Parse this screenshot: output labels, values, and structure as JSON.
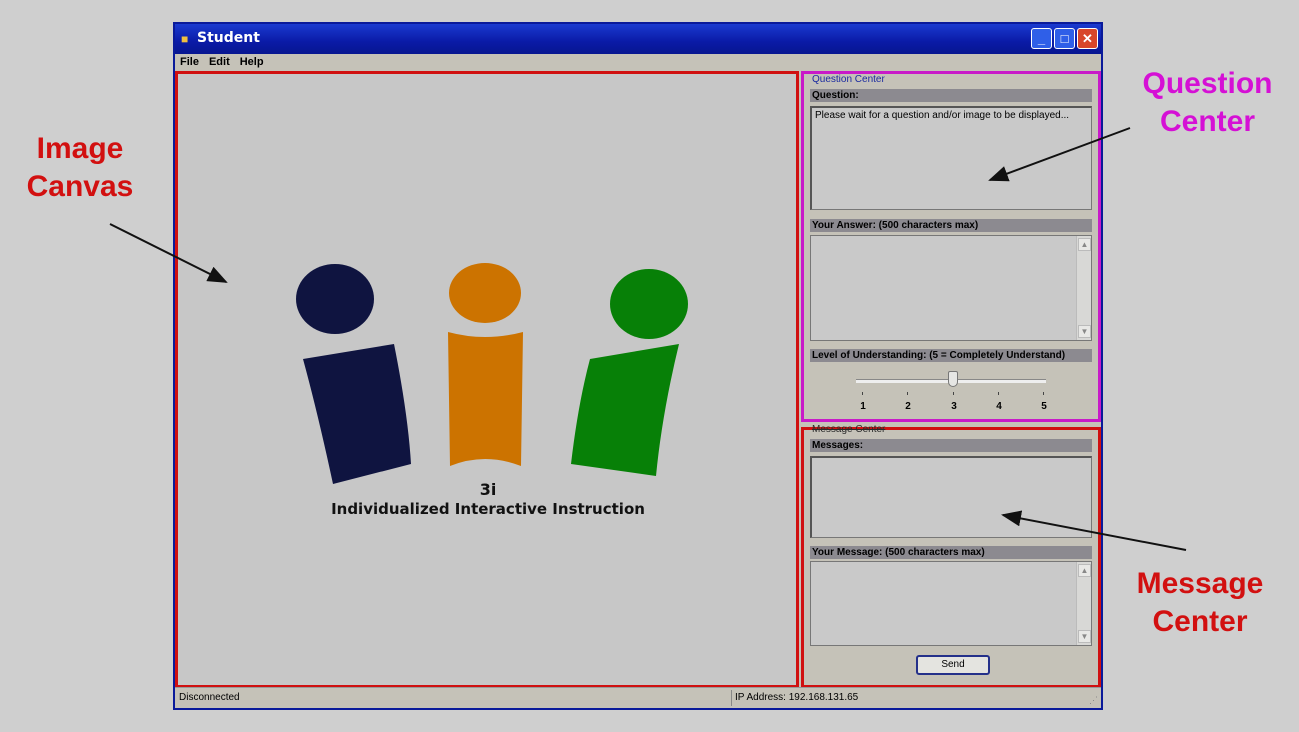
{
  "annotations": {
    "image_canvas": "Image\nCanvas",
    "question_center": "Question\nCenter",
    "message_center": "Message\nCenter"
  },
  "window": {
    "title": "Student",
    "menu": [
      "File",
      "Edit",
      "Help"
    ]
  },
  "canvas": {
    "logo_name": "3i",
    "logo_subtitle": "Individualized Interactive Instruction",
    "logo_colors": [
      "#0f1440",
      "#cc7300",
      "#078007"
    ]
  },
  "question_center": {
    "title": "Question Center",
    "question_label": "Question:",
    "question_text": "Please wait for a question and/or image to be displayed...",
    "answer_label": "Your Answer: (500 characters max)",
    "answer_value": "",
    "understanding_label": "Level of Understanding: (5 = Completely Understand)",
    "scale": [
      "1",
      "2",
      "3",
      "4",
      "5"
    ],
    "selected_level": 3
  },
  "message_center": {
    "title": "Message Center",
    "messages_label": "Messages:",
    "messages_value": "",
    "your_message_label": "Your Message: (500 characters max)",
    "your_message_value": "",
    "send_label": "Send"
  },
  "status": {
    "connection": "Disconnected",
    "ip": "IP Address: 192.168.131.65"
  },
  "colors": {
    "canvas_border": "#d01010",
    "question_border": "#c81ac8",
    "titlebar": "#0a1aa6"
  }
}
